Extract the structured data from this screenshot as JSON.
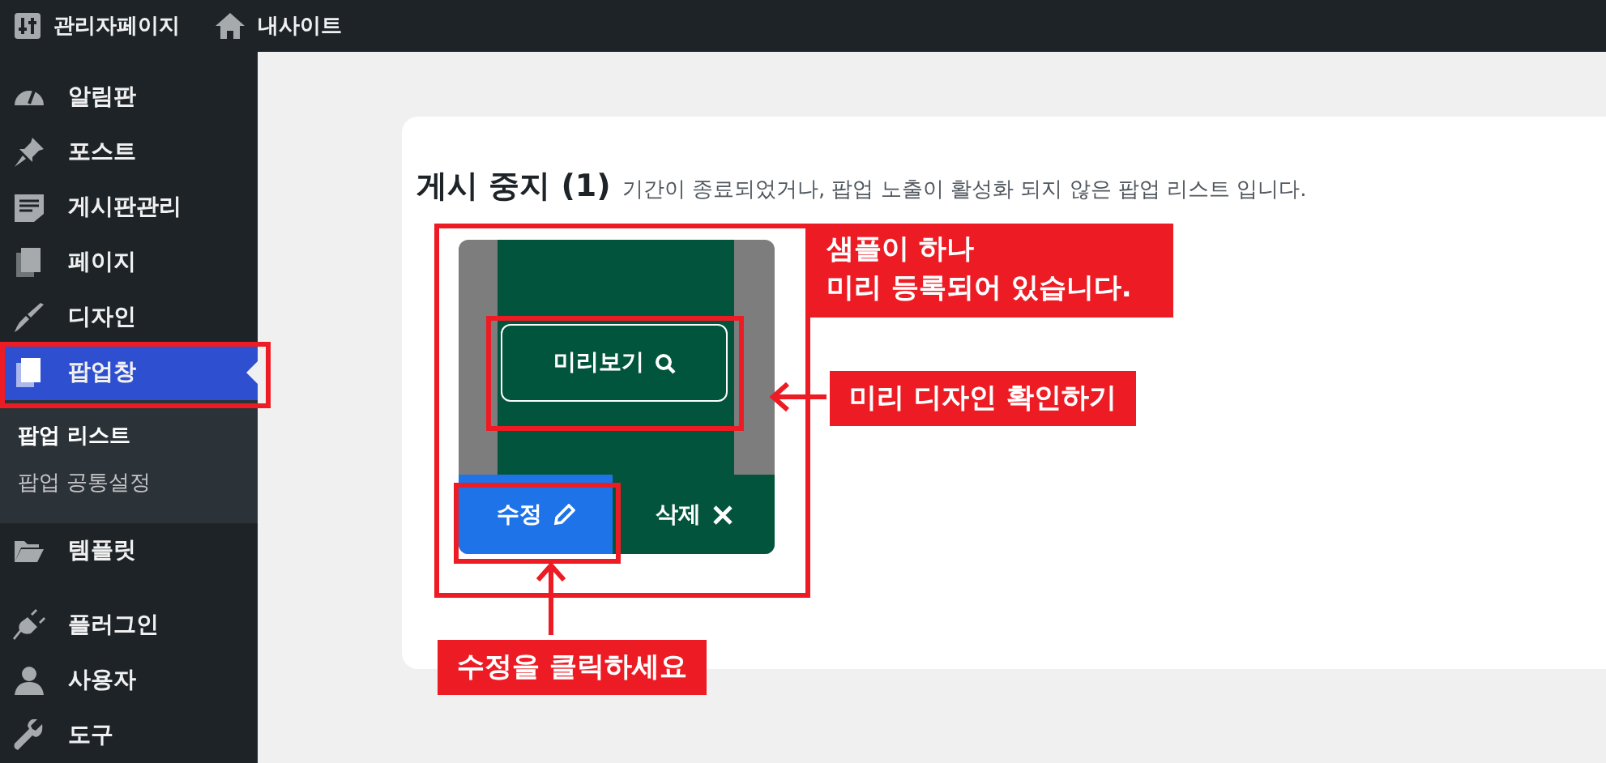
{
  "top_bar": {
    "items": [
      {
        "label": "관리자페이지"
      },
      {
        "label": "내사이트"
      }
    ]
  },
  "sidebar": {
    "items": [
      {
        "label": "알림판",
        "selected": false
      },
      {
        "label": "포스트",
        "selected": false
      },
      {
        "label": "게시판관리",
        "selected": false
      },
      {
        "label": "페이지",
        "selected": false
      },
      {
        "label": "디자인",
        "selected": false
      },
      {
        "label": "팝업창",
        "selected": true,
        "children": [
          {
            "label": "팝업 리스트",
            "selected": true
          },
          {
            "label": "팝업 공통설정",
            "selected": false
          }
        ]
      },
      {
        "label": "템플릿",
        "selected": false
      },
      {
        "label": "플러그인",
        "selected": false
      },
      {
        "label": "사용자",
        "selected": false
      },
      {
        "label": "도구",
        "selected": false
      }
    ]
  },
  "section": {
    "title": "게시 중지",
    "count": "(1)",
    "description": "기간이 종료되었거나, 팝업 노출이 활성화 되지 않은 팝업 리스트 입니다."
  },
  "popup_card": {
    "preview_label": "미리보기",
    "edit_button": "수정",
    "delete_button": "삭제"
  },
  "annotations": {
    "sample_note": [
      "샘플이 하나",
      "미리 등록되어 있습니다."
    ],
    "preview_note": "미리 디자인 확인하기",
    "edit_note": "수정을 클릭하세요"
  }
}
